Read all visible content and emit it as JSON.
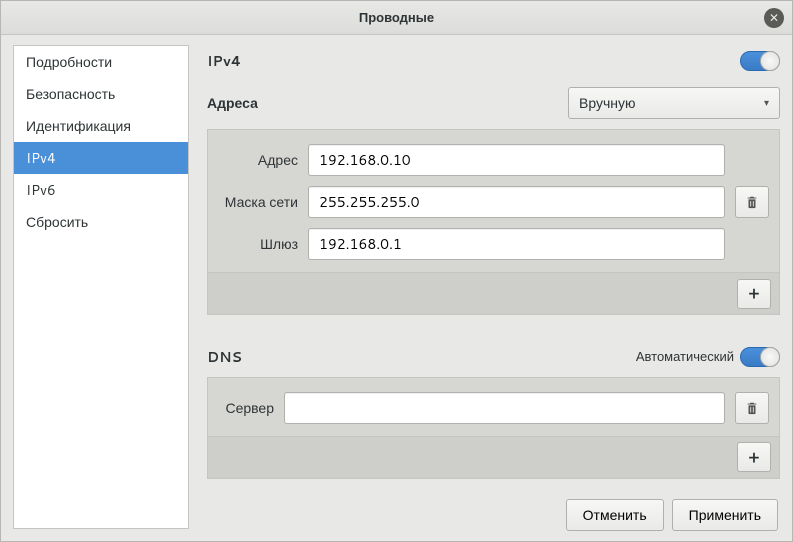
{
  "window": {
    "title": "Проводные"
  },
  "sidebar": {
    "items": [
      {
        "label": "Подробности"
      },
      {
        "label": "Безопасность"
      },
      {
        "label": "Идентификация"
      },
      {
        "label": "IPv4"
      },
      {
        "label": "IPv6"
      },
      {
        "label": "Сбросить"
      }
    ],
    "selected_index": 3
  },
  "ipv4": {
    "heading": "IPv4",
    "addresses_label": "Адреса",
    "method_selected": "Вручную",
    "address": {
      "label": "Адрес",
      "value": "192.168.0.10"
    },
    "netmask": {
      "label": "Маска сети",
      "value": "255.255.255.0"
    },
    "gateway": {
      "label": "Шлюз",
      "value": "192.168.0.1"
    }
  },
  "dns": {
    "heading": "DNS",
    "auto_label": "Автоматический",
    "server_label": "Сервер",
    "server_value": ""
  },
  "footer": {
    "cancel": "Отменить",
    "apply": "Применить"
  },
  "icons": {
    "plus": "+",
    "close": "✕",
    "arrow": "▾"
  }
}
